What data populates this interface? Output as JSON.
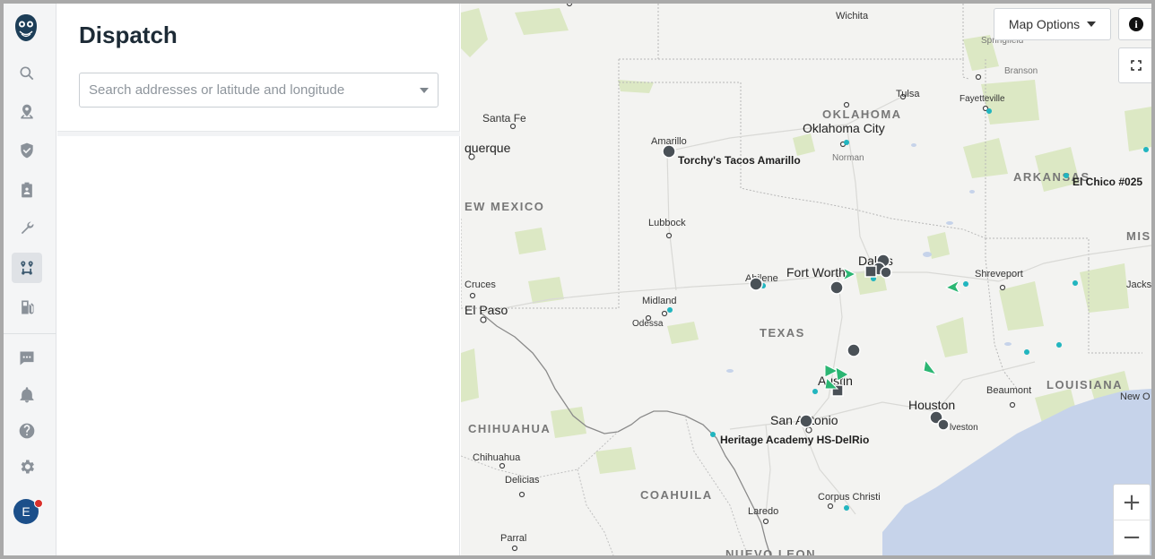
{
  "app": {
    "title": "Dispatch"
  },
  "nav": {
    "items": [
      {
        "name": "search-icon",
        "active": false
      },
      {
        "name": "map-pin-icon",
        "active": false
      },
      {
        "name": "shield-icon",
        "active": false
      },
      {
        "name": "clipboard-icon",
        "active": false
      },
      {
        "name": "wrench-icon",
        "active": false
      },
      {
        "name": "dispatch-route-icon",
        "active": true
      },
      {
        "name": "fuel-icon",
        "active": false
      },
      {
        "name": "messages-icon",
        "active": false
      },
      {
        "name": "bell-icon",
        "active": false
      },
      {
        "name": "help-icon",
        "active": false
      },
      {
        "name": "gear-icon",
        "active": false
      }
    ],
    "avatar_initial": "E",
    "avatar_color": "#1b4f8a",
    "notification_color": "#d9302b"
  },
  "search": {
    "placeholder": "Search addresses or latitude and longitude"
  },
  "map": {
    "options_label": "Map Options",
    "zoom_in": "+",
    "zoom_out": "−",
    "labels": {
      "wichita": "Wichita",
      "springfield": "Springfield",
      "branson": "Branson",
      "tulsa": "Tulsa",
      "fayetteville": "Fayetteville",
      "oklahoma": "OKLAHOMA",
      "oklahoma_city": "Oklahoma City",
      "norman": "Norman",
      "santa_fe": "Santa Fe",
      "albuquerque": "querque",
      "amarillo": "Amarillo",
      "torchys": "Torchy's Tacos Amarillo",
      "arkansas": "ARKANSAS",
      "el_chico": "El Chico #025",
      "new_mexico": "EW MEXICO",
      "lubbock": "Lubbock",
      "mis": "MIS",
      "dallas": "Dallas",
      "fort_worth": "Fort Worth",
      "abilene": "Abilene",
      "shreveport": "Shreveport",
      "jackson": "Jacks",
      "las_cruces": "Cruces",
      "el_paso": "El Paso",
      "midland": "Midland",
      "odessa": "Odessa",
      "texas": "TEXAS",
      "austin": "Austin",
      "beaumont": "Beaumont",
      "louisiana": "LOUISIANA",
      "houston": "Houston",
      "galveston": "lveston",
      "new_orleans": "New O",
      "chihuahua_state": "CHIHUAHUA",
      "san_antonio": "San Antonio",
      "heritage": "Heritage Academy HS-DelRio",
      "chihuahua": "Chihuahua",
      "delicias": "Delicias",
      "coahuila": "COAHUILA",
      "corpus_christi": "Corpus Christi",
      "laredo": "Laredo",
      "parral": "Parral",
      "nuevo_leon": "NUEVO LEON"
    },
    "colors": {
      "land": "#f3f3f1",
      "water": "#c6d3ea",
      "park": "#dce8c4",
      "vehicle": "#4a5157",
      "arrow": "#2bb673",
      "pin": "#22b5bf"
    }
  }
}
